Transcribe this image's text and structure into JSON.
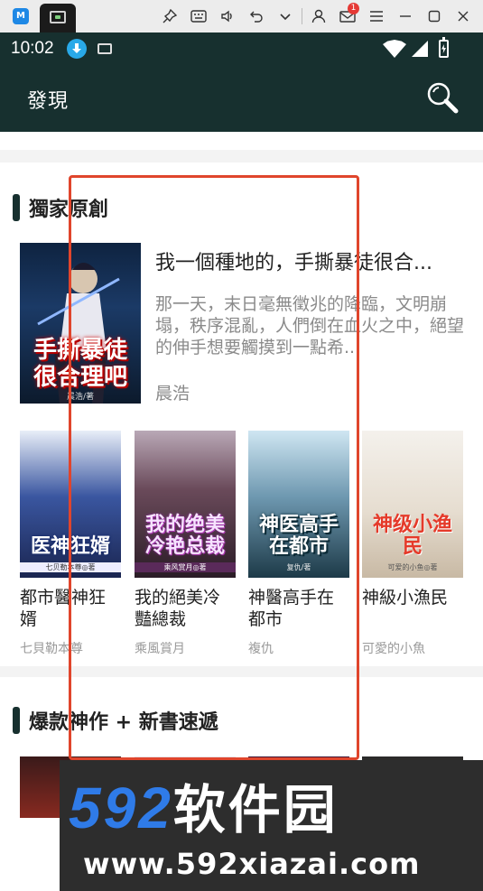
{
  "emulator": {
    "icons": [
      "pin-icon",
      "keyboard-icon",
      "volume-icon",
      "undo-icon",
      "chevron-down-icon",
      "user-icon",
      "mail-icon",
      "menu-icon",
      "minimize-icon",
      "maximize-icon",
      "close-icon"
    ],
    "mail_badge": "1"
  },
  "status_bar": {
    "time": "10:02"
  },
  "header": {
    "title": "發現"
  },
  "section1": {
    "title": "獨家原創",
    "featured": {
      "title": "我一個種地的，手撕暴徒很合...",
      "description": "那一天，末日毫無徵兆的降臨，文明崩塌，秩序混亂，人們倒在血火之中，絕望的伸手想要觸摸到一點希...",
      "author": "晨浩",
      "cover_text": "手撕暴徒很合理吧",
      "cover_sub": "晨浩/著"
    },
    "books": [
      {
        "name": "都市醫神狂婿",
        "author": "七貝勒本尊",
        "cover_text": "医神狂婿",
        "cover_sub": "七贝勒本尊◎著",
        "color": "#2a3c7a"
      },
      {
        "name": "我的絕美冷豔總裁",
        "author": "乘風賞月",
        "cover_text": "我的绝美冷艳总裁",
        "cover_sub": "乘风赏月◎著",
        "color": "#3a2a3a"
      },
      {
        "name": "神醫高手在都市",
        "author": "複仇",
        "cover_text": "神医高手在都市",
        "cover_sub": "复仇/著",
        "color": "#1f4a3a"
      },
      {
        "name": "神級小漁民",
        "author": "可愛的小魚",
        "cover_text": "神级小渔民",
        "cover_sub": "可爱的小鱼◎著",
        "color": "#d9d2c4"
      }
    ]
  },
  "section2": {
    "title": "爆款神作 + 新書速遞"
  },
  "watermark": {
    "brand_num": "592",
    "brand_text": "软件园",
    "url": "www.592xiazai.com"
  },
  "colors": {
    "header_bg": "#17302f",
    "highlight_box": "#e0452c",
    "watermark_blue": "#2f7be8"
  }
}
